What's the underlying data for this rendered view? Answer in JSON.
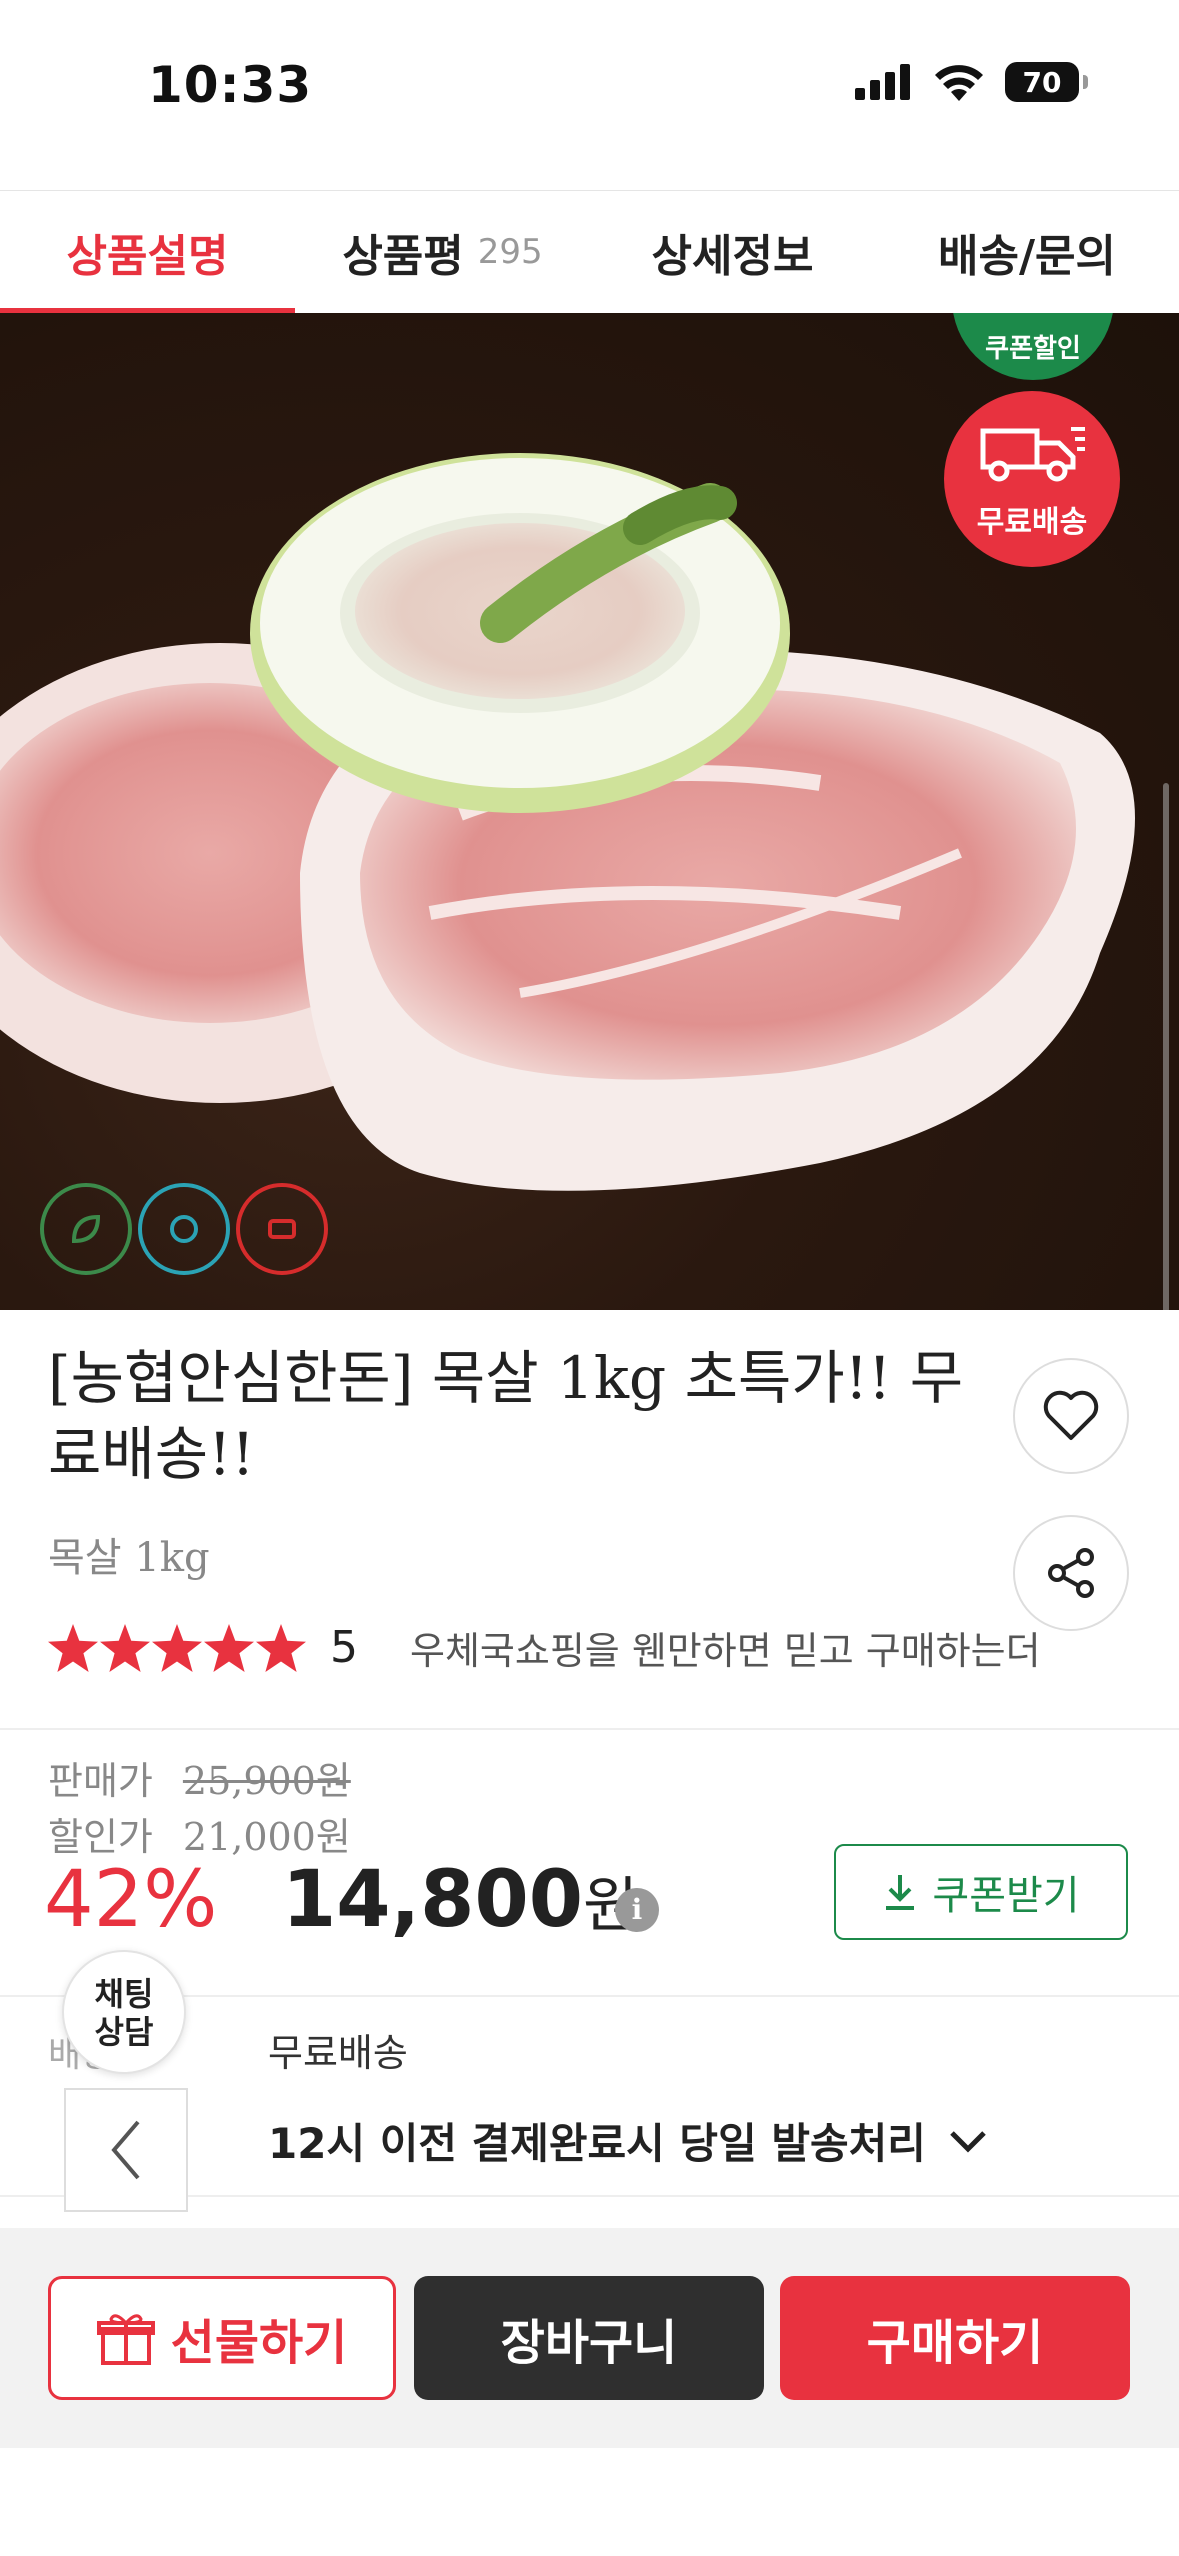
{
  "status_bar": {
    "time": "10:33",
    "battery": "70"
  },
  "tabs": [
    {
      "label": "상품설명",
      "count": ""
    },
    {
      "label": "상품평",
      "count": "295"
    },
    {
      "label": "상세정보",
      "count": ""
    },
    {
      "label": "배송/문의",
      "count": ""
    }
  ],
  "image_badges": {
    "coupon": "쿠폰할인",
    "free_shipping": "무료배송"
  },
  "product": {
    "title": "[농협안심한돈] 목살 1kg 초특가!! 무료배송!!",
    "subtitle": "목살 1kg",
    "rating": "5",
    "review_snippet": "우체국쇼핑을 웬만하면 믿고 구매하는더"
  },
  "pricing": {
    "sale_label": "판매가",
    "sale_price": "25,900원",
    "discount_label": "할인가",
    "discount_price": "21,000원",
    "discount_rate": "42%",
    "final_price": "14,800",
    "currency": "원",
    "info_icon": "i",
    "coupon_button": "쿠폰받기"
  },
  "chat": {
    "line1": "채팅",
    "line2": "상담"
  },
  "shipping": {
    "label": "배송",
    "value": "무료배송",
    "note": "12시 이전 결제완료시 당일 발송처리"
  },
  "actions": {
    "gift": "선물하기",
    "cart": "장바구니",
    "buy": "구매하기"
  },
  "colors": {
    "accent": "#e8323f",
    "green": "#1c8a4a",
    "dark": "#2f2f2f"
  }
}
